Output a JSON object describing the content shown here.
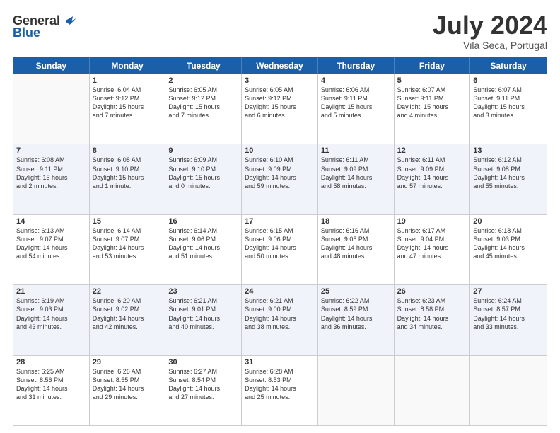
{
  "header": {
    "logo": {
      "general": "General",
      "blue": "Blue"
    },
    "title": "July 2024",
    "location": "Vila Seca, Portugal"
  },
  "weekdays": [
    "Sunday",
    "Monday",
    "Tuesday",
    "Wednesday",
    "Thursday",
    "Friday",
    "Saturday"
  ],
  "rows": [
    {
      "cells": [
        {
          "day": "",
          "empty": true
        },
        {
          "day": "1",
          "line1": "Sunrise: 6:04 AM",
          "line2": "Sunset: 9:12 PM",
          "line3": "Daylight: 15 hours",
          "line4": "and 7 minutes."
        },
        {
          "day": "2",
          "line1": "Sunrise: 6:05 AM",
          "line2": "Sunset: 9:12 PM",
          "line3": "Daylight: 15 hours",
          "line4": "and 7 minutes."
        },
        {
          "day": "3",
          "line1": "Sunrise: 6:05 AM",
          "line2": "Sunset: 9:12 PM",
          "line3": "Daylight: 15 hours",
          "line4": "and 6 minutes."
        },
        {
          "day": "4",
          "line1": "Sunrise: 6:06 AM",
          "line2": "Sunset: 9:11 PM",
          "line3": "Daylight: 15 hours",
          "line4": "and 5 minutes."
        },
        {
          "day": "5",
          "line1": "Sunrise: 6:07 AM",
          "line2": "Sunset: 9:11 PM",
          "line3": "Daylight: 15 hours",
          "line4": "and 4 minutes."
        },
        {
          "day": "6",
          "line1": "Sunrise: 6:07 AM",
          "line2": "Sunset: 9:11 PM",
          "line3": "Daylight: 15 hours",
          "line4": "and 3 minutes."
        }
      ]
    },
    {
      "alt": true,
      "cells": [
        {
          "day": "7",
          "line1": "Sunrise: 6:08 AM",
          "line2": "Sunset: 9:11 PM",
          "line3": "Daylight: 15 hours",
          "line4": "and 2 minutes."
        },
        {
          "day": "8",
          "line1": "Sunrise: 6:08 AM",
          "line2": "Sunset: 9:10 PM",
          "line3": "Daylight: 15 hours",
          "line4": "and 1 minute."
        },
        {
          "day": "9",
          "line1": "Sunrise: 6:09 AM",
          "line2": "Sunset: 9:10 PM",
          "line3": "Daylight: 15 hours",
          "line4": "and 0 minutes."
        },
        {
          "day": "10",
          "line1": "Sunrise: 6:10 AM",
          "line2": "Sunset: 9:09 PM",
          "line3": "Daylight: 14 hours",
          "line4": "and 59 minutes."
        },
        {
          "day": "11",
          "line1": "Sunrise: 6:11 AM",
          "line2": "Sunset: 9:09 PM",
          "line3": "Daylight: 14 hours",
          "line4": "and 58 minutes."
        },
        {
          "day": "12",
          "line1": "Sunrise: 6:11 AM",
          "line2": "Sunset: 9:09 PM",
          "line3": "Daylight: 14 hours",
          "line4": "and 57 minutes."
        },
        {
          "day": "13",
          "line1": "Sunrise: 6:12 AM",
          "line2": "Sunset: 9:08 PM",
          "line3": "Daylight: 14 hours",
          "line4": "and 55 minutes."
        }
      ]
    },
    {
      "cells": [
        {
          "day": "14",
          "line1": "Sunrise: 6:13 AM",
          "line2": "Sunset: 9:07 PM",
          "line3": "Daylight: 14 hours",
          "line4": "and 54 minutes."
        },
        {
          "day": "15",
          "line1": "Sunrise: 6:14 AM",
          "line2": "Sunset: 9:07 PM",
          "line3": "Daylight: 14 hours",
          "line4": "and 53 minutes."
        },
        {
          "day": "16",
          "line1": "Sunrise: 6:14 AM",
          "line2": "Sunset: 9:06 PM",
          "line3": "Daylight: 14 hours",
          "line4": "and 51 minutes."
        },
        {
          "day": "17",
          "line1": "Sunrise: 6:15 AM",
          "line2": "Sunset: 9:06 PM",
          "line3": "Daylight: 14 hours",
          "line4": "and 50 minutes."
        },
        {
          "day": "18",
          "line1": "Sunrise: 6:16 AM",
          "line2": "Sunset: 9:05 PM",
          "line3": "Daylight: 14 hours",
          "line4": "and 48 minutes."
        },
        {
          "day": "19",
          "line1": "Sunrise: 6:17 AM",
          "line2": "Sunset: 9:04 PM",
          "line3": "Daylight: 14 hours",
          "line4": "and 47 minutes."
        },
        {
          "day": "20",
          "line1": "Sunrise: 6:18 AM",
          "line2": "Sunset: 9:03 PM",
          "line3": "Daylight: 14 hours",
          "line4": "and 45 minutes."
        }
      ]
    },
    {
      "alt": true,
      "cells": [
        {
          "day": "21",
          "line1": "Sunrise: 6:19 AM",
          "line2": "Sunset: 9:03 PM",
          "line3": "Daylight: 14 hours",
          "line4": "and 43 minutes."
        },
        {
          "day": "22",
          "line1": "Sunrise: 6:20 AM",
          "line2": "Sunset: 9:02 PM",
          "line3": "Daylight: 14 hours",
          "line4": "and 42 minutes."
        },
        {
          "day": "23",
          "line1": "Sunrise: 6:21 AM",
          "line2": "Sunset: 9:01 PM",
          "line3": "Daylight: 14 hours",
          "line4": "and 40 minutes."
        },
        {
          "day": "24",
          "line1": "Sunrise: 6:21 AM",
          "line2": "Sunset: 9:00 PM",
          "line3": "Daylight: 14 hours",
          "line4": "and 38 minutes."
        },
        {
          "day": "25",
          "line1": "Sunrise: 6:22 AM",
          "line2": "Sunset: 8:59 PM",
          "line3": "Daylight: 14 hours",
          "line4": "and 36 minutes."
        },
        {
          "day": "26",
          "line1": "Sunrise: 6:23 AM",
          "line2": "Sunset: 8:58 PM",
          "line3": "Daylight: 14 hours",
          "line4": "and 34 minutes."
        },
        {
          "day": "27",
          "line1": "Sunrise: 6:24 AM",
          "line2": "Sunset: 8:57 PM",
          "line3": "Daylight: 14 hours",
          "line4": "and 33 minutes."
        }
      ]
    },
    {
      "cells": [
        {
          "day": "28",
          "line1": "Sunrise: 6:25 AM",
          "line2": "Sunset: 8:56 PM",
          "line3": "Daylight: 14 hours",
          "line4": "and 31 minutes."
        },
        {
          "day": "29",
          "line1": "Sunrise: 6:26 AM",
          "line2": "Sunset: 8:55 PM",
          "line3": "Daylight: 14 hours",
          "line4": "and 29 minutes."
        },
        {
          "day": "30",
          "line1": "Sunrise: 6:27 AM",
          "line2": "Sunset: 8:54 PM",
          "line3": "Daylight: 14 hours",
          "line4": "and 27 minutes."
        },
        {
          "day": "31",
          "line1": "Sunrise: 6:28 AM",
          "line2": "Sunset: 8:53 PM",
          "line3": "Daylight: 14 hours",
          "line4": "and 25 minutes."
        },
        {
          "day": "",
          "empty": true
        },
        {
          "day": "",
          "empty": true
        },
        {
          "day": "",
          "empty": true
        }
      ]
    }
  ]
}
